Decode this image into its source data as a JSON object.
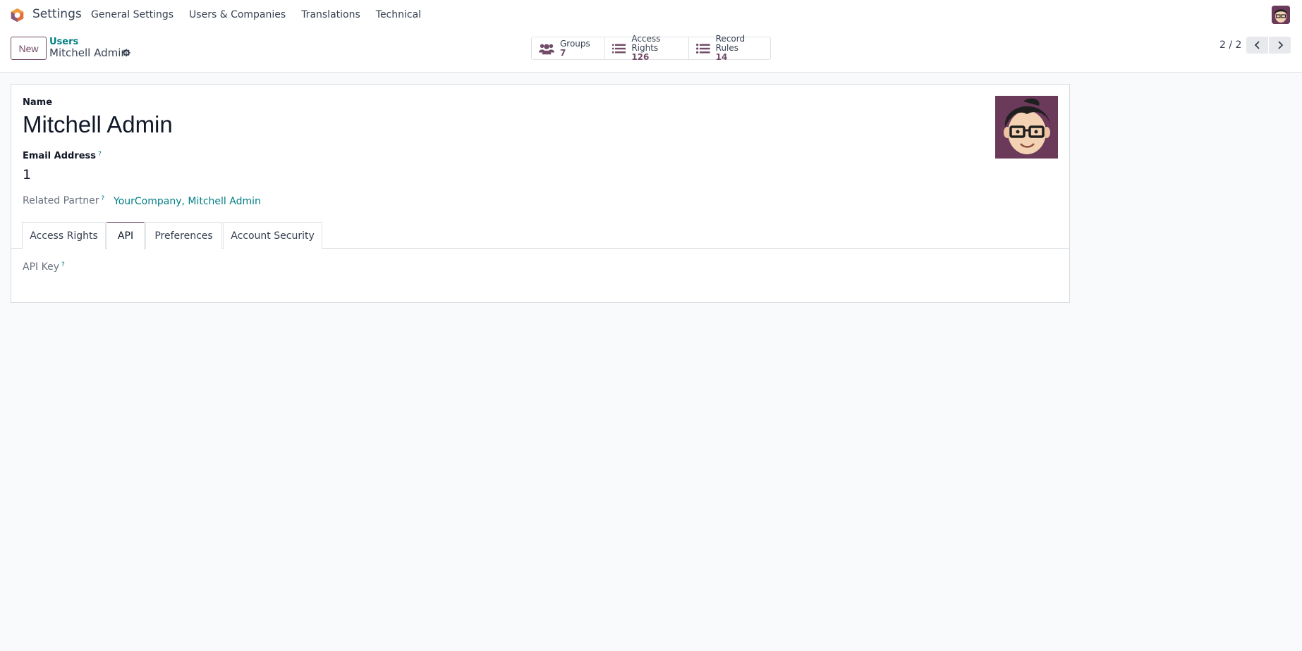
{
  "navbar": {
    "app_name": "Settings",
    "menu": [
      "General Settings",
      "Users & Companies",
      "Translations",
      "Technical"
    ]
  },
  "control": {
    "new_label": "New",
    "breadcrumb_parent": "Users",
    "breadcrumb_current": "Mitchell Admin",
    "stats": [
      {
        "label": "Groups",
        "value": "7",
        "icon": "users-icon"
      },
      {
        "label": "Access Rights",
        "value": "126",
        "icon": "list-icon"
      },
      {
        "label": "Record Rules",
        "value": "14",
        "icon": "list-icon"
      }
    ],
    "pager": "2 / 2"
  },
  "form": {
    "name_label": "Name",
    "name_value": "Mitchell Admin",
    "email_label": "Email Address",
    "help_mark": "?",
    "email_value": "1",
    "partner_label": "Related Partner",
    "partner_value": "YourCompany, Mitchell Admin",
    "tabs": [
      "Access Rights",
      "API",
      "Preferences",
      "Account Security"
    ],
    "active_tab": "API",
    "api_key_label": "API Key"
  },
  "colors": {
    "brand": "#714b67",
    "link": "#017e84"
  }
}
